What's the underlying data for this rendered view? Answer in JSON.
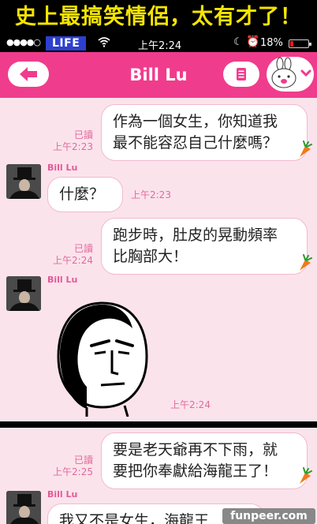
{
  "banner": {
    "text": "史上最搞笑情侶，太有才了！"
  },
  "status_bar": {
    "signal": "●●●●○",
    "carrier": "LIFE",
    "time": "上午2:24",
    "battery_percent": "18%",
    "battery_level": 0.18
  },
  "nav": {
    "title": "Bill Lu"
  },
  "messages": [
    {
      "type": "sent",
      "lines": [
        "作為一個女生，你知道我",
        "最不能容忍自己什麼嗎？"
      ],
      "read": "已讀",
      "time": "上午2:23"
    },
    {
      "type": "received",
      "sender": "Bill Lu",
      "text": "什麼？",
      "time": "上午2:23"
    },
    {
      "type": "sent",
      "lines": [
        "跑步時，肚皮的晃動頻率",
        "比胸部大！"
      ],
      "read": "已讀",
      "time": "上午2:24"
    },
    {
      "type": "received_sticker",
      "sender": "Bill Lu",
      "time": "上午2:24"
    },
    {
      "type": "sent",
      "lines": [
        "要是老天爺再不下雨，就",
        "要把你奉獻給海龍王了！"
      ],
      "read": "已讀",
      "time": "上午2:25"
    },
    {
      "type": "received",
      "sender": "Bill Lu",
      "text": "我又不是女生，海龍王"
    }
  ],
  "watermark": "funpeer.com",
  "colors": {
    "accent": "#f03c8c",
    "chat_bg": "#fbe3ec",
    "banner_text": "#f5e400",
    "carrier_bg": "#2d3fcf"
  }
}
